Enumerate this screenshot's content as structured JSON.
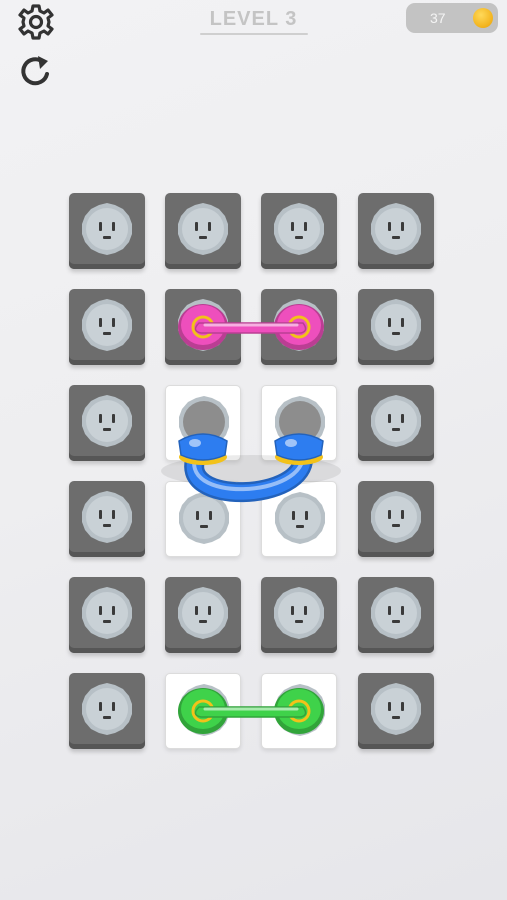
{
  "header": {
    "level_label": "LEVEL 3",
    "coins": "37"
  },
  "icons": {
    "settings": "gear-icon",
    "restart": "restart-icon",
    "coin": "coin-icon"
  },
  "board": {
    "rows": 6,
    "cols": 4,
    "white_tiles": [
      [
        2,
        1
      ],
      [
        2,
        2
      ],
      [
        3,
        1
      ],
      [
        3,
        2
      ],
      [
        5,
        1
      ],
      [
        5,
        2
      ]
    ],
    "plugged_tiles": [
      [
        2,
        1
      ],
      [
        2,
        2
      ]
    ]
  },
  "cables": [
    {
      "name": "pink-cable",
      "color": "#ee4fbd",
      "ends": [
        [
          1,
          1
        ],
        [
          1,
          2
        ]
      ],
      "style": "flat"
    },
    {
      "name": "blue-cable",
      "color": "#2d7df0",
      "ends": [
        [
          2,
          1
        ],
        [
          2,
          2
        ]
      ],
      "style": "plug"
    },
    {
      "name": "green-cable",
      "color": "#3fd24a",
      "ends": [
        [
          5,
          1
        ],
        [
          5,
          2
        ]
      ],
      "style": "flat"
    }
  ],
  "colors": {
    "dark_tile": "#6d6d6d",
    "white_tile": "#ffffff",
    "socket_face": "#c9d1d6",
    "coin": "#f2b21b"
  }
}
